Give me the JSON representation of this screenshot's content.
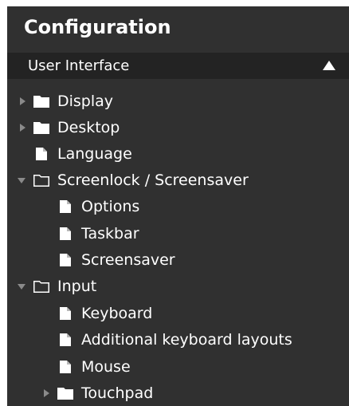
{
  "panel": {
    "title": "Configuration"
  },
  "section": {
    "label": "User Interface",
    "collapse_icon": "triangle-up-icon"
  },
  "tree": {
    "items": [
      {
        "label": "Display",
        "icon": "folder-filled-icon",
        "expander": "collapsed"
      },
      {
        "label": "Desktop",
        "icon": "folder-filled-icon",
        "expander": "collapsed"
      },
      {
        "label": "Language",
        "icon": "document-icon",
        "expander": "none"
      },
      {
        "label": "Screenlock / Screensaver",
        "icon": "folder-open-icon",
        "expander": "expanded"
      },
      {
        "label": "Options",
        "icon": "document-icon",
        "expander": "none"
      },
      {
        "label": "Taskbar",
        "icon": "document-icon",
        "expander": "none"
      },
      {
        "label": "Screensaver",
        "icon": "document-icon",
        "expander": "none"
      },
      {
        "label": "Input",
        "icon": "folder-open-icon",
        "expander": "expanded"
      },
      {
        "label": "Keyboard",
        "icon": "document-icon",
        "expander": "none"
      },
      {
        "label": "Additional keyboard layouts",
        "icon": "document-icon",
        "expander": "none"
      },
      {
        "label": "Mouse",
        "icon": "document-icon",
        "expander": "none"
      },
      {
        "label": "Touchpad",
        "icon": "folder-filled-icon",
        "expander": "collapsed"
      }
    ]
  },
  "colors": {
    "panel_background": "#303030",
    "header_background": "#232323",
    "text": "#ffffff",
    "expander": "#8a8a8a"
  }
}
